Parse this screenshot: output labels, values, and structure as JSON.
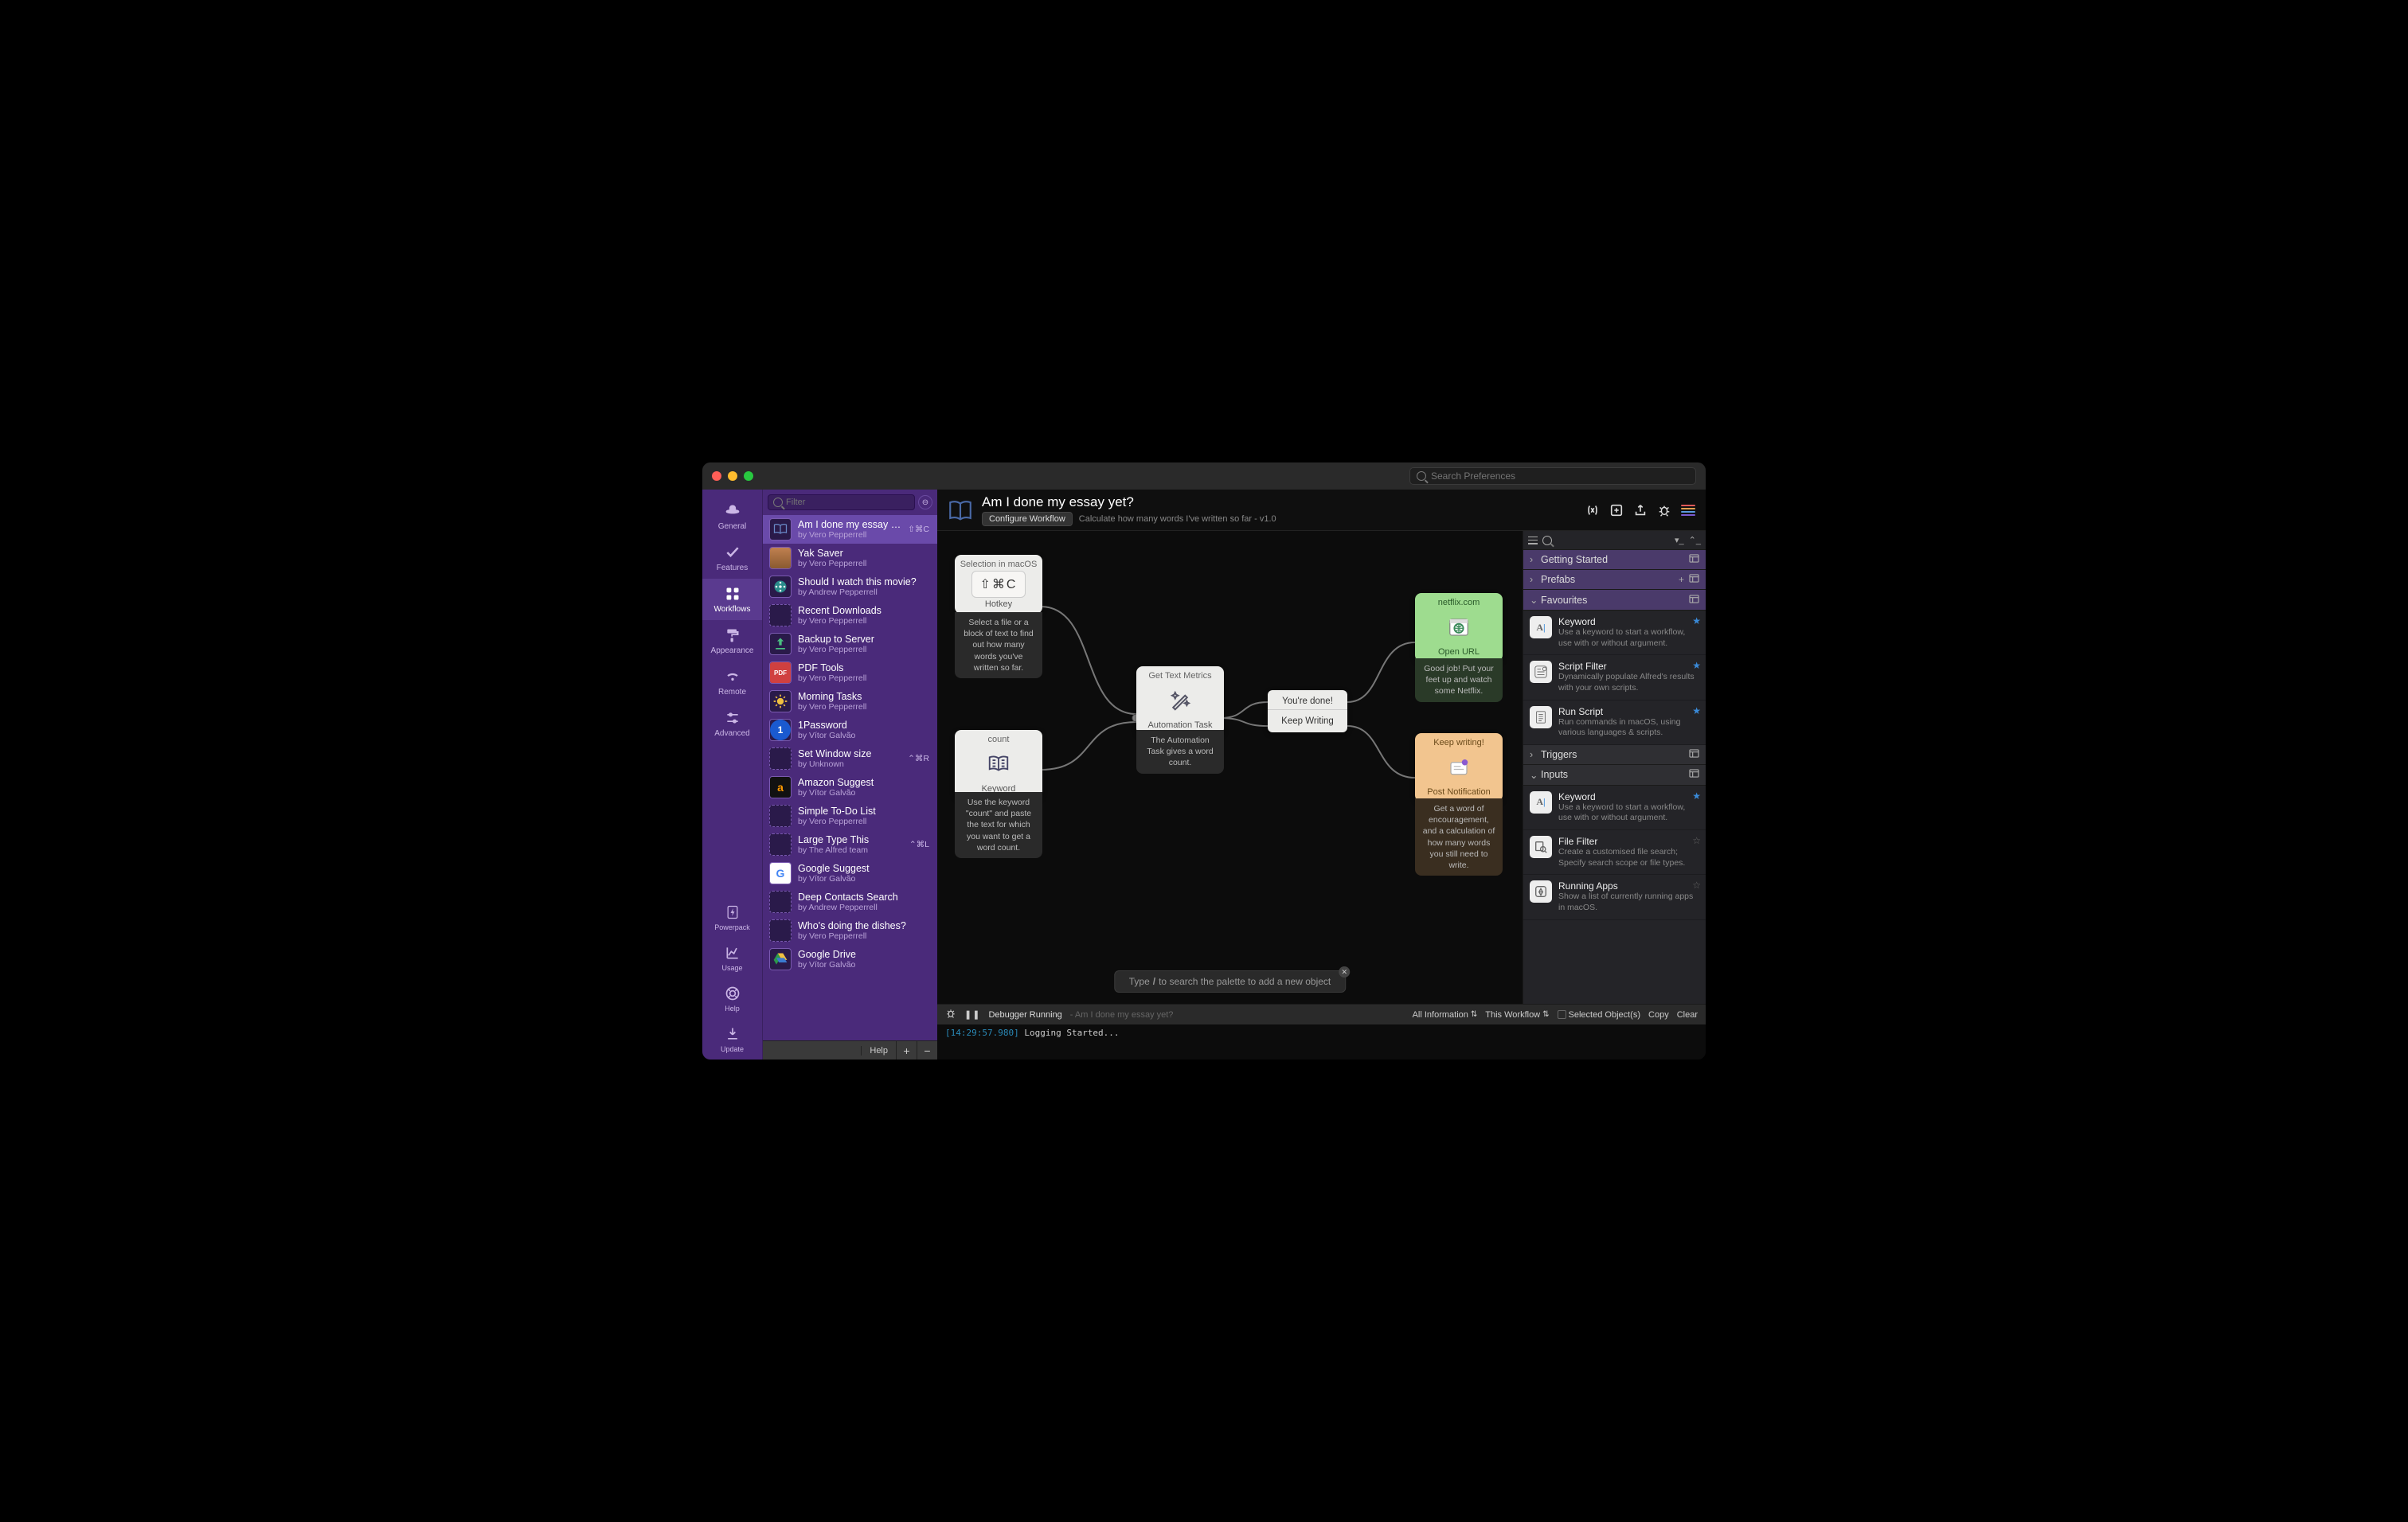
{
  "searchPlaceholder": "Search Preferences",
  "nav": [
    {
      "id": "general",
      "label": "General",
      "icon": "hat"
    },
    {
      "id": "features",
      "label": "Features",
      "icon": "check"
    },
    {
      "id": "workflows",
      "label": "Workflows",
      "icon": "grid",
      "selected": true
    },
    {
      "id": "appearance",
      "label": "Appearance",
      "icon": "roller"
    },
    {
      "id": "remote",
      "label": "Remote",
      "icon": "signal"
    },
    {
      "id": "advanced",
      "label": "Advanced",
      "icon": "sliders"
    }
  ],
  "navBottom": [
    {
      "id": "powerpack",
      "label": "Powerpack",
      "icon": "bolt"
    },
    {
      "id": "usage",
      "label": "Usage",
      "icon": "chart"
    },
    {
      "id": "help",
      "label": "Help",
      "icon": "life"
    },
    {
      "id": "update",
      "label": "Update",
      "icon": "download"
    }
  ],
  "filterPlaceholder": "Filter",
  "workflows": [
    {
      "title": "Am I done my essay yet?",
      "author": "by Vero Pepperrell",
      "shortcut": "⇧⌘C",
      "selected": true,
      "thumb": "book"
    },
    {
      "title": "Yak Saver",
      "author": "by Vero Pepperrell",
      "thumb": "yak"
    },
    {
      "title": "Should I watch this movie?",
      "author": "by Andrew Pepperrell",
      "thumb": "reel"
    },
    {
      "title": "Recent Downloads",
      "author": "by Vero Pepperrell",
      "thumb": "placeholder"
    },
    {
      "title": "Backup to Server",
      "author": "by Vero Pepperrell",
      "thumb": "upload"
    },
    {
      "title": "PDF Tools",
      "author": "by Vero Pepperrell",
      "thumb": "pdf"
    },
    {
      "title": "Morning Tasks",
      "author": "by Vero Pepperrell",
      "thumb": "sun"
    },
    {
      "title": "1Password",
      "author": "by Vítor Galvão",
      "thumb": "1p"
    },
    {
      "title": "Set Window size",
      "author": "by Unknown",
      "shortcut": "⌃⌘R",
      "thumb": "placeholder"
    },
    {
      "title": "Amazon Suggest",
      "author": "by Vítor Galvão",
      "thumb": "amazon"
    },
    {
      "title": "Simple To-Do List",
      "author": "by Vero Pepperrell",
      "thumb": "placeholder"
    },
    {
      "title": "Large Type This",
      "author": "by The Alfred team",
      "shortcut": "⌃⌘L",
      "thumb": "placeholder"
    },
    {
      "title": "Google Suggest",
      "author": "by Vítor Galvão",
      "thumb": "google"
    },
    {
      "title": "Deep Contacts Search",
      "author": "by Andrew Pepperrell",
      "thumb": "placeholder"
    },
    {
      "title": "Who's doing the dishes?",
      "author": "by Vero Pepperrell",
      "thumb": "placeholder"
    },
    {
      "title": "Google Drive",
      "author": "by Vítor Galvão",
      "thumb": "gdrive"
    }
  ],
  "footerHelp": "Help",
  "header": {
    "title": "Am I done my essay yet?",
    "configure": "Configure Workflow",
    "description": "Calculate how many words I've written so far - v1.0"
  },
  "nodes": {
    "hotkey": {
      "top": "Selection in macOS",
      "key": "⇧⌘C",
      "label": "Hotkey",
      "desc": "Select a file or a block of text to find out how many words you've written so far."
    },
    "keyword": {
      "top": "count",
      "label": "Keyword",
      "desc": "Use the keyword \"count\" and paste the text for which you want to get a word count."
    },
    "auto": {
      "top": "Get Text Metrics",
      "label": "Automation Task",
      "desc": "The Automation Task gives a word count."
    },
    "branch": {
      "a": "You're done!",
      "b": "Keep Writing"
    },
    "openurl": {
      "top": "netflix.com",
      "label": "Open URL",
      "desc": "Good job! Put your feet up and watch some Netflix."
    },
    "notify": {
      "top": "Keep writing!",
      "label": "Post Notification",
      "desc": "Get a word of encouragement, and a calculation of how many words you still need to write."
    }
  },
  "palettePrompt": {
    "pre": "Type ",
    "key": "/",
    "post": " to search the palette to add a new object"
  },
  "palette": {
    "sections": [
      {
        "id": "getting",
        "label": "Getting Started",
        "open": false,
        "style": "purple",
        "actions": [
          "layout"
        ]
      },
      {
        "id": "prefabs",
        "label": "Prefabs",
        "open": false,
        "style": "purple",
        "actions": [
          "plus",
          "layout"
        ]
      },
      {
        "id": "favourites",
        "label": "Favourites",
        "open": true,
        "style": "purple",
        "actions": [
          "layout"
        ],
        "items": [
          {
            "title": "Keyword",
            "desc": "Use a keyword to start a workflow, use with or without argument.",
            "icon": "A|",
            "star": true
          },
          {
            "title": "Script Filter",
            "desc": "Dynamically populate Alfred's results with your own scripts.",
            "icon": "list",
            "star": true
          },
          {
            "title": "Run Script",
            "desc": "Run commands in macOS, using various languages & scripts.",
            "icon": "doc",
            "star": true
          }
        ]
      },
      {
        "id": "triggers",
        "label": "Triggers",
        "open": false,
        "style": "dark",
        "actions": [
          "layout"
        ]
      },
      {
        "id": "inputs",
        "label": "Inputs",
        "open": true,
        "style": "dark",
        "actions": [
          "layout"
        ],
        "items": [
          {
            "title": "Keyword",
            "desc": "Use a keyword to start a workflow, use with or without argument.",
            "icon": "A|",
            "star": true
          },
          {
            "title": "File Filter",
            "desc": "Create a customised file search; Specify search scope or file types.",
            "icon": "mag",
            "star": false
          },
          {
            "title": "Running Apps",
            "desc": "Show a list of currently running apps in macOS.",
            "icon": "app",
            "star": false
          }
        ]
      }
    ]
  },
  "debugger": {
    "status": "Debugger Running",
    "sub": "Am I done my essay yet?",
    "filter1": "All Information",
    "filter2": "This Workflow",
    "selObjs": "Selected Object(s)",
    "copy": "Copy",
    "clear": "Clear",
    "logTs": "[14:29:57.980]",
    "logMsg": "Logging Started..."
  }
}
